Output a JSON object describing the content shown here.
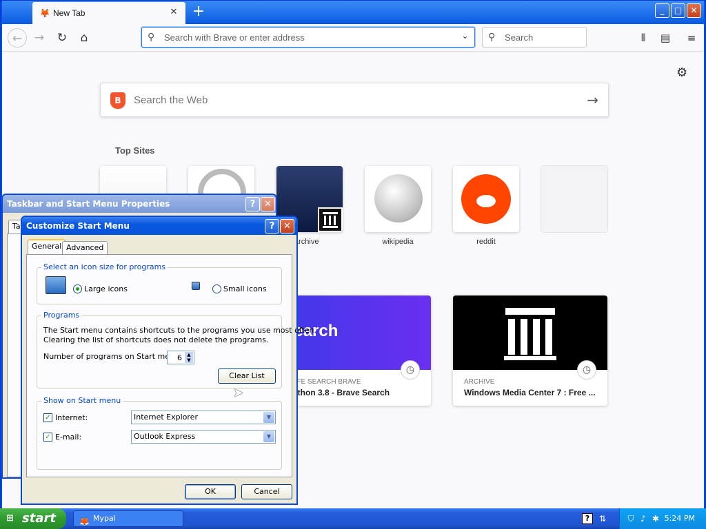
{
  "browser": {
    "tab_title": "New Tab",
    "tab_close": "✕",
    "new_tab": "+",
    "url_placeholder": "Search with Brave or enter address",
    "search_placeholder": "Search",
    "web_search_placeholder": "Search the Web",
    "top_sites_title": "Top Sites",
    "top_sites": [
      {
        "label": ""
      },
      {
        "label": ""
      },
      {
        "label": "archive"
      },
      {
        "label": "wikipedia"
      },
      {
        "label": "reddit"
      },
      {
        "label": ""
      }
    ],
    "highlights": [
      {
        "source": "SAFE SEARCH BRAVE",
        "title": "Python 3.8 - Brave Search",
        "image_text": "search"
      },
      {
        "source": "ARCHIVE",
        "title": "Windows Media Center 7 : Free ..."
      }
    ],
    "accent_color": "#0054e3"
  },
  "taskbar_props": {
    "title": "Taskbar and Start Menu Properties",
    "tab_partial": "Ta",
    "help": "?",
    "close": "✕"
  },
  "customize": {
    "title": "Customize Start Menu",
    "help": "?",
    "close": "✕",
    "tabs": [
      "General",
      "Advanced"
    ],
    "icon_size_group": "Select an icon size for programs",
    "large_icons": "Large icons",
    "small_icons": "Small icons",
    "programs_group": "Programs",
    "programs_desc_1": "The Start menu contains shortcuts to the programs you use most often.",
    "programs_desc_2": "Clearing the list of shortcuts does not delete the programs.",
    "num_programs_label": "Number of programs on Start menu:",
    "num_programs_value": "6",
    "clear_list": "Clear List",
    "show_group": "Show on Start menu",
    "internet_label": "Internet:",
    "internet_value": "Internet Explorer",
    "email_label": "E-mail:",
    "email_value": "Outlook Express",
    "ok": "OK",
    "cancel": "Cancel"
  },
  "taskbar": {
    "start": "start",
    "task_item": "Mypal",
    "clock": "5:24 PM",
    "help": "?"
  }
}
